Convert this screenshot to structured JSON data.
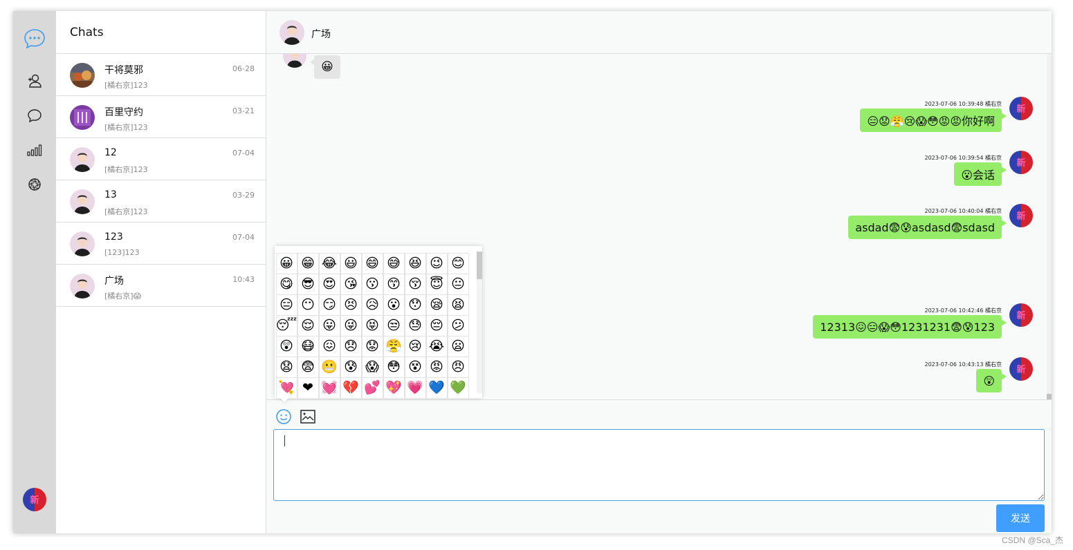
{
  "colors": {
    "accent": "#409eff",
    "bubble_self": "#95ec69",
    "bubble_other": "#e5e5e5",
    "rail": "#d9d9d9"
  },
  "rail": {
    "icons": [
      "chat-bubble-icon",
      "add-user-icon",
      "comment-icon",
      "signal-bars-icon",
      "aperture-icon"
    ]
  },
  "chatlist": {
    "title": "Chats",
    "items": [
      {
        "name": "干将莫邪",
        "preview": "[橘右京]123",
        "date": "06-28"
      },
      {
        "name": "百里守约",
        "preview": "[橘右京]123",
        "date": "03-21"
      },
      {
        "name": "12",
        "preview": "[橘右京]123",
        "date": "07-04"
      },
      {
        "name": "13",
        "preview": "[橘右京]123",
        "date": "03-29"
      },
      {
        "name": "123",
        "preview": "[123]123",
        "date": "07-04"
      },
      {
        "name": "广场",
        "preview": "[橘右京]😱",
        "date": "10:43"
      }
    ]
  },
  "panel": {
    "title": "广场",
    "left_message": {
      "text": "😀"
    },
    "messages": [
      {
        "meta": "2023-07-06 10:39:48 橘右京",
        "text": "😑😟😤😢😱😳😡😡你好啊"
      },
      {
        "meta": "2023-07-06 10:39:54 橘右京",
        "text": "😮会话"
      },
      {
        "meta": "2023-07-06 10:40:04 橘右京",
        "text": "asdad😨😰asdasd😨sdasd"
      },
      {
        "meta": "2023-07-06 10:42:46 橘右京",
        "text": "12313😖😑😱😳1231231😨😰123"
      },
      {
        "meta": "2023-07-06 10:43:13 橘右京",
        "text": "😲"
      }
    ]
  },
  "emoji_panel": {
    "emojis": [
      "😀",
      "😁",
      "😂",
      "😃",
      "😄",
      "😅",
      "😆",
      "😉",
      "😊",
      "😋",
      "😎",
      "😍",
      "😘",
      "😗",
      "😙",
      "😚",
      "😇",
      "😐",
      "😑",
      "😶",
      "😏",
      "😣",
      "😥",
      "😮",
      "😯",
      "😪",
      "😫",
      "😴",
      "😌",
      "😛",
      "😜",
      "😝",
      "😒",
      "😓",
      "😔",
      "😕",
      "😲",
      "😷",
      "😖",
      "😞",
      "😟",
      "😤",
      "😢",
      "😭",
      "😦",
      "😧",
      "😨",
      "😬",
      "😰",
      "😱",
      "😳",
      "😵",
      "😡",
      "😠",
      "💘",
      "❤",
      "💓",
      "💔",
      "💕",
      "💖",
      "💗",
      "💙",
      "💚"
    ]
  },
  "composer": {
    "tools": [
      "smile-icon",
      "image-icon"
    ],
    "input_value": "",
    "send_label": "发送"
  },
  "watermark": "CSDN @Sca_杰"
}
